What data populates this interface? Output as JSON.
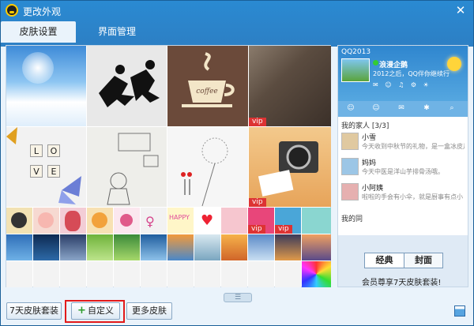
{
  "window": {
    "title": "更改外观",
    "close_glyph": "✕"
  },
  "tabs": [
    {
      "label": "皮肤设置",
      "active": true
    },
    {
      "label": "界面管理",
      "active": false
    }
  ],
  "skins": {
    "vip_badge": "vip",
    "scrabble": {
      "row1": [
        "L",
        "O"
      ],
      "row2": [
        "V",
        "E"
      ]
    },
    "coffee_text": "coffee",
    "happy_text": "HAPPY"
  },
  "preview": {
    "title": "QQ2013",
    "nickname": "浪漫企鹅",
    "signature": "2012之后，QQ伴你继续行",
    "icons_line": "✉ ☺ ♫ ⚙ ☀",
    "tab_glyphs": [
      "☺",
      "☺",
      "✉",
      "✱",
      "⌕"
    ],
    "groups": [
      {
        "label": "我的家人 [3/3]"
      },
      {
        "label": "我的同"
      }
    ],
    "contacts": [
      {
        "name": "小雪",
        "sig": "今天收到中秋节的礼物，是一盒冰皮月饼"
      },
      {
        "name": "妈妈",
        "sig": "今天中医是洋山芋排骨汤哦。"
      },
      {
        "name": "小阿姨",
        "sig": "啦啦的手会有小伞，就是厨事有点小"
      }
    ],
    "switch": {
      "left": "经典",
      "right": "封面"
    },
    "vip_promo": "会员尊享7天皮肤套装!"
  },
  "handle_glyph": "☰",
  "bottom": {
    "btn_7day": "7天皮肤套装",
    "btn_custom": "自定义",
    "btn_custom_plus": "+",
    "btn_more": "更多皮肤"
  }
}
